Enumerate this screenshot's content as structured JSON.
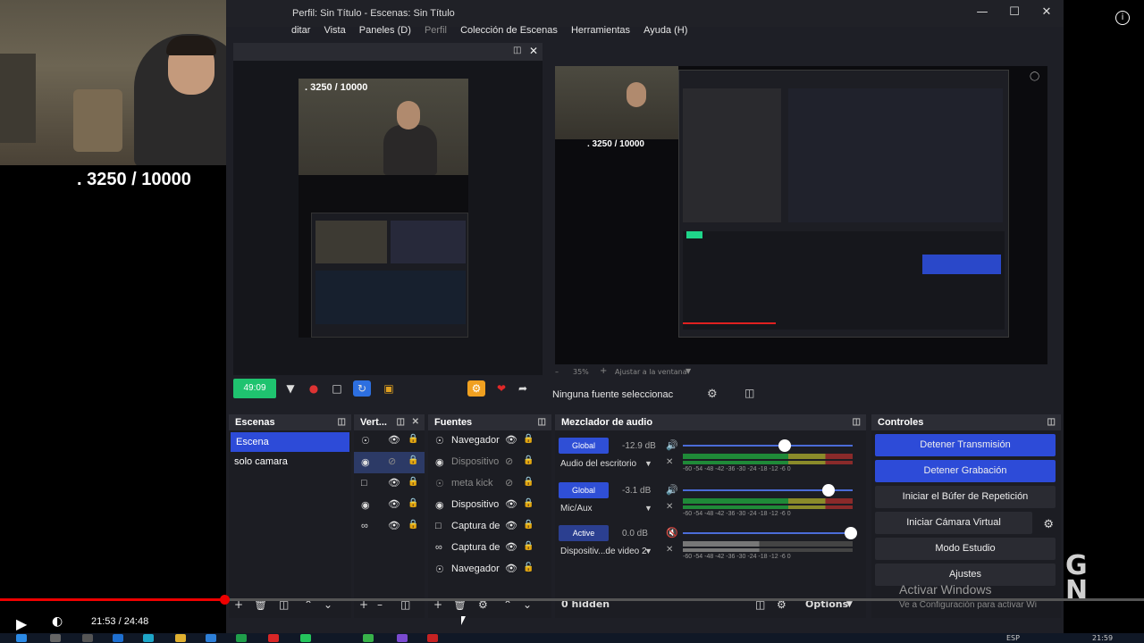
{
  "video": {
    "counter_text": ". 3250 / 10000",
    "time": "21:53 / 24:48",
    "progress": 0.197
  },
  "obs": {
    "title": "Perfil: Sin Título - Escenas: Sin Título",
    "menu": [
      "ditar",
      "Vista",
      "Paneles (D)",
      "Perfil",
      "Colección de Escenas",
      "Herramientas",
      "Ayuda (H)"
    ],
    "stream_timer": "49:09",
    "zoom": "35%",
    "fit_label": "Ajustar a la ventana",
    "no_source": "Ninguna fuente seleccionac",
    "docks": {
      "scenes": {
        "title": "Escenas",
        "items": [
          "Escena",
          "solo camara"
        ]
      },
      "vertical": {
        "title": "Vert..."
      },
      "sources": {
        "title": "Fuentes",
        "items": [
          "Navegador",
          "Dispositivo",
          "meta kick",
          "Dispositivo",
          "Captura de",
          "Captura de",
          "Navegador"
        ]
      },
      "mixer": {
        "title": "Mezclador de audio",
        "channels": [
          {
            "badge": "Global",
            "db": "-12.9 dB",
            "name": "Audio del escritorio",
            "level": 0.6
          },
          {
            "badge": "Global",
            "db": "-3.1 dB",
            "name": "Mic/Aux",
            "level": 0.86
          },
          {
            "badge": "Active",
            "db": "0.0 dB",
            "name": "Dispositiv...de video 2",
            "level": 0.99
          }
        ],
        "scale": [
          "-60",
          "-54",
          "-48",
          "-42",
          "-36",
          "-30",
          "-24",
          "-18",
          "-12",
          "-6",
          "0"
        ],
        "hidden": "0 hidden",
        "options": "Options"
      },
      "controls": {
        "title": "Controles",
        "buttons": [
          "Detener Transmisión",
          "Detener Grabación",
          "Iniciar el Búfer de Repetición",
          "Iniciar Cámara Virtual",
          "Modo Estudio",
          "Ajustes"
        ]
      }
    }
  },
  "windows": {
    "activate_title": "Activar Windows",
    "activate_sub": "Ve a Configuración para activar Wi",
    "lang": "ESP",
    "clock": "21:59"
  },
  "colors": {
    "accent": "#2d4bd8",
    "stream_green": "#1fc36f",
    "progress_red": "#e00000"
  }
}
